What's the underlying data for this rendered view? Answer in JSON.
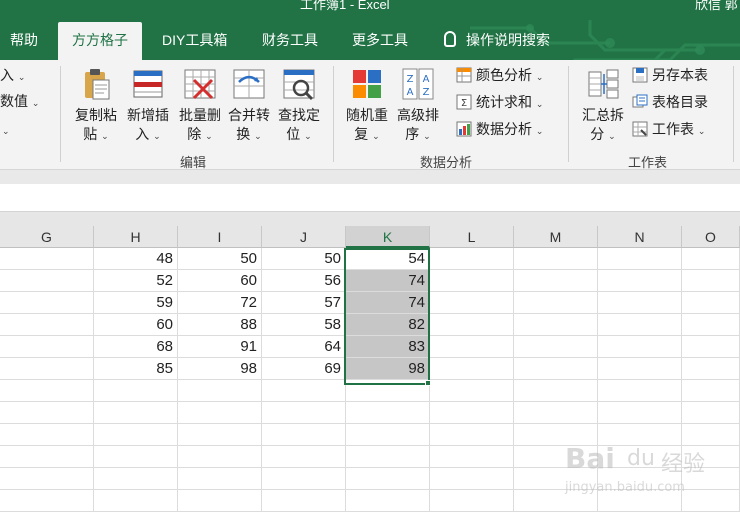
{
  "window": {
    "title": "工作簿1 - Excel",
    "user": "欣信 郭"
  },
  "ribbon_tabs": [
    {
      "label": "帮助",
      "active": false
    },
    {
      "label": "方方格子",
      "active": true
    },
    {
      "label": "DIY工具箱",
      "active": false
    },
    {
      "label": "财务工具",
      "active": false
    },
    {
      "label": "更多工具",
      "active": false
    },
    {
      "label": "操作说明搜索",
      "active": false
    }
  ],
  "ribbon": {
    "partial": {
      "item1": "入",
      "item2": "数值"
    },
    "edit_group": {
      "label": "编辑",
      "buttons": [
        {
          "line1": "复制粘",
          "line2": "贴"
        },
        {
          "line1": "新增插",
          "line2": "入"
        },
        {
          "line1": "批量删",
          "line2": "除"
        },
        {
          "line1": "合并转",
          "line2": "换"
        },
        {
          "line1": "查找定",
          "line2": "位"
        }
      ]
    },
    "data_group": {
      "label": "数据分析",
      "buttons": [
        {
          "line1": "随机重",
          "line2": "复"
        },
        {
          "line1": "高级排",
          "line2": "序"
        }
      ],
      "small": [
        "颜色分析",
        "统计求和",
        "数据分析"
      ]
    },
    "sheet_group": {
      "label": "工作表",
      "button": {
        "line1": "汇总拆",
        "line2": "分"
      },
      "small": [
        "另存本表",
        "表格目录",
        "工作表"
      ]
    }
  },
  "grid": {
    "columns": [
      "G",
      "H",
      "I",
      "J",
      "K",
      "L",
      "M",
      "N",
      "O"
    ],
    "selected_column": "K",
    "rows": [
      [
        "",
        "48",
        "50",
        "50",
        "54",
        "",
        "",
        "",
        ""
      ],
      [
        "",
        "52",
        "60",
        "56",
        "74",
        "",
        "",
        "",
        ""
      ],
      [
        "",
        "59",
        "72",
        "57",
        "74",
        "",
        "",
        "",
        ""
      ],
      [
        "",
        "60",
        "88",
        "58",
        "82",
        "",
        "",
        "",
        ""
      ],
      [
        "",
        "68",
        "91",
        "64",
        "83",
        "",
        "",
        "",
        ""
      ],
      [
        "",
        "85",
        "98",
        "69",
        "98",
        "",
        "",
        "",
        ""
      ]
    ],
    "shaded_cells": [
      "K2",
      "K3",
      "K4",
      "K5",
      "K6"
    ]
  },
  "watermark": {
    "brand": "Bai",
    "paw": "du",
    "suffix": "经验",
    "url": "jingyan.baidu.com"
  },
  "colors": {
    "accent": "#217346",
    "shade": "#c6c6c6"
  }
}
